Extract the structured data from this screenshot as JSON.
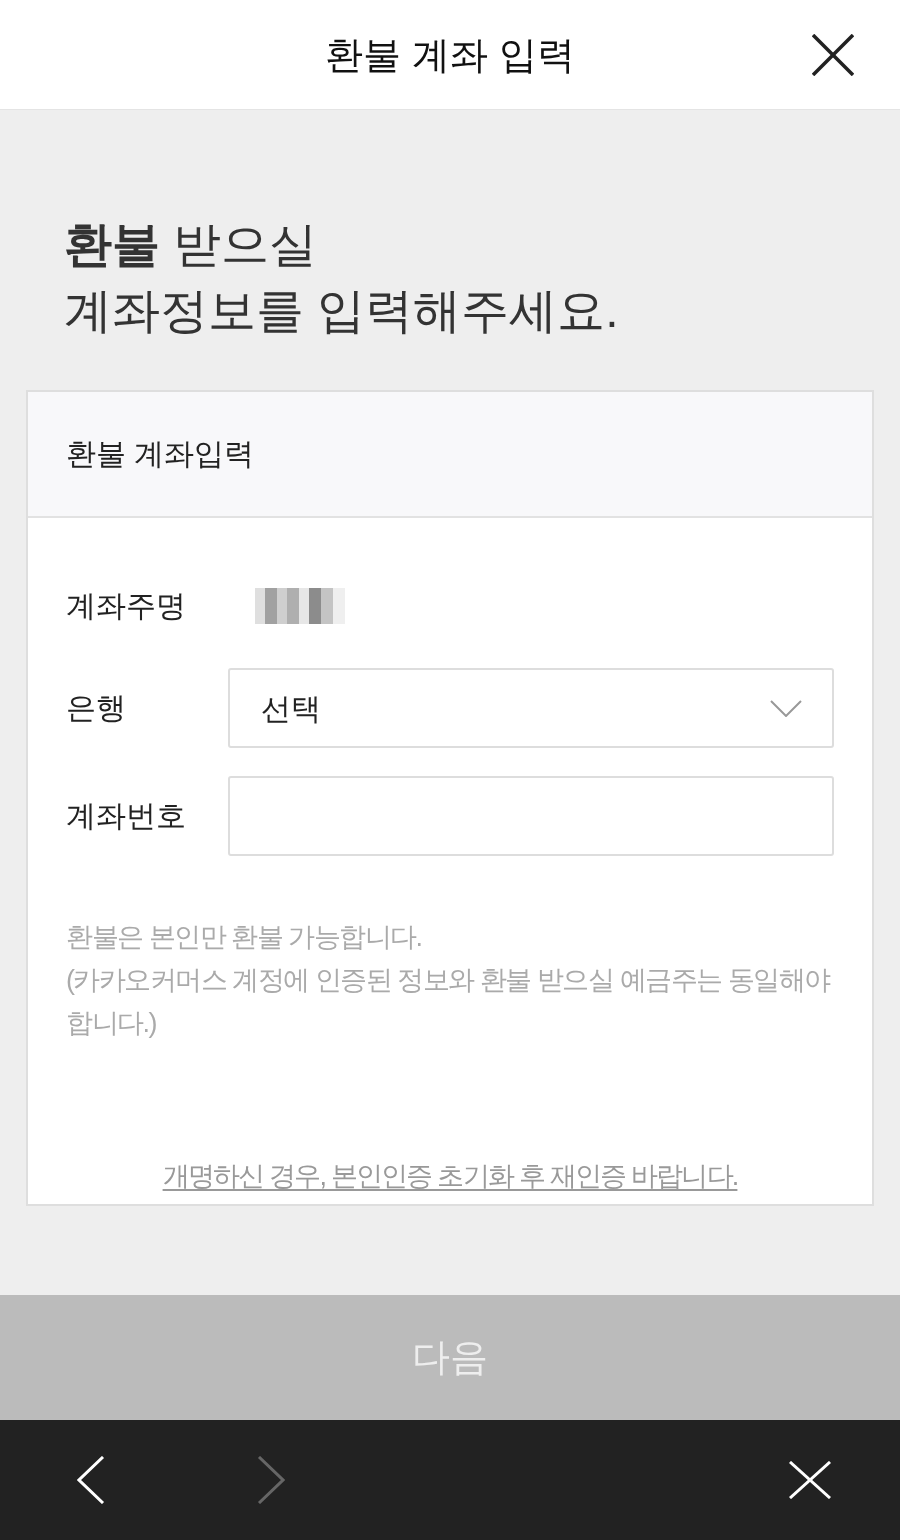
{
  "header": {
    "title": "환불 계좌 입력"
  },
  "intro": {
    "lines": [
      "**환불** 받으실",
      "계좌정보를 입력해주세요."
    ]
  },
  "card": {
    "title": "환불 계좌입력",
    "fields": [
      {
        "kind": "redacted",
        "label": "계좌주명"
      },
      {
        "kind": "select",
        "label": "은행",
        "value": "선택"
      },
      {
        "kind": "input",
        "label": "계좌번호"
      }
    ],
    "notice": [
      "환불은 본인만 환불 가능합니다.",
      "(카카오커머스 계정에 인증된 정보와 환불 받으실 예금주는 동일해야 합니다.)"
    ],
    "link": "개명하신 경우, 본인인증 초기화 후 재인증 바랍니다."
  },
  "next_button": {
    "label": "다음",
    "disabled": true
  },
  "nav_bar": [
    {
      "kind": "back",
      "disabled": false
    },
    {
      "kind": "forward",
      "disabled": true
    },
    {
      "kind": "close",
      "disabled": false
    }
  ]
}
